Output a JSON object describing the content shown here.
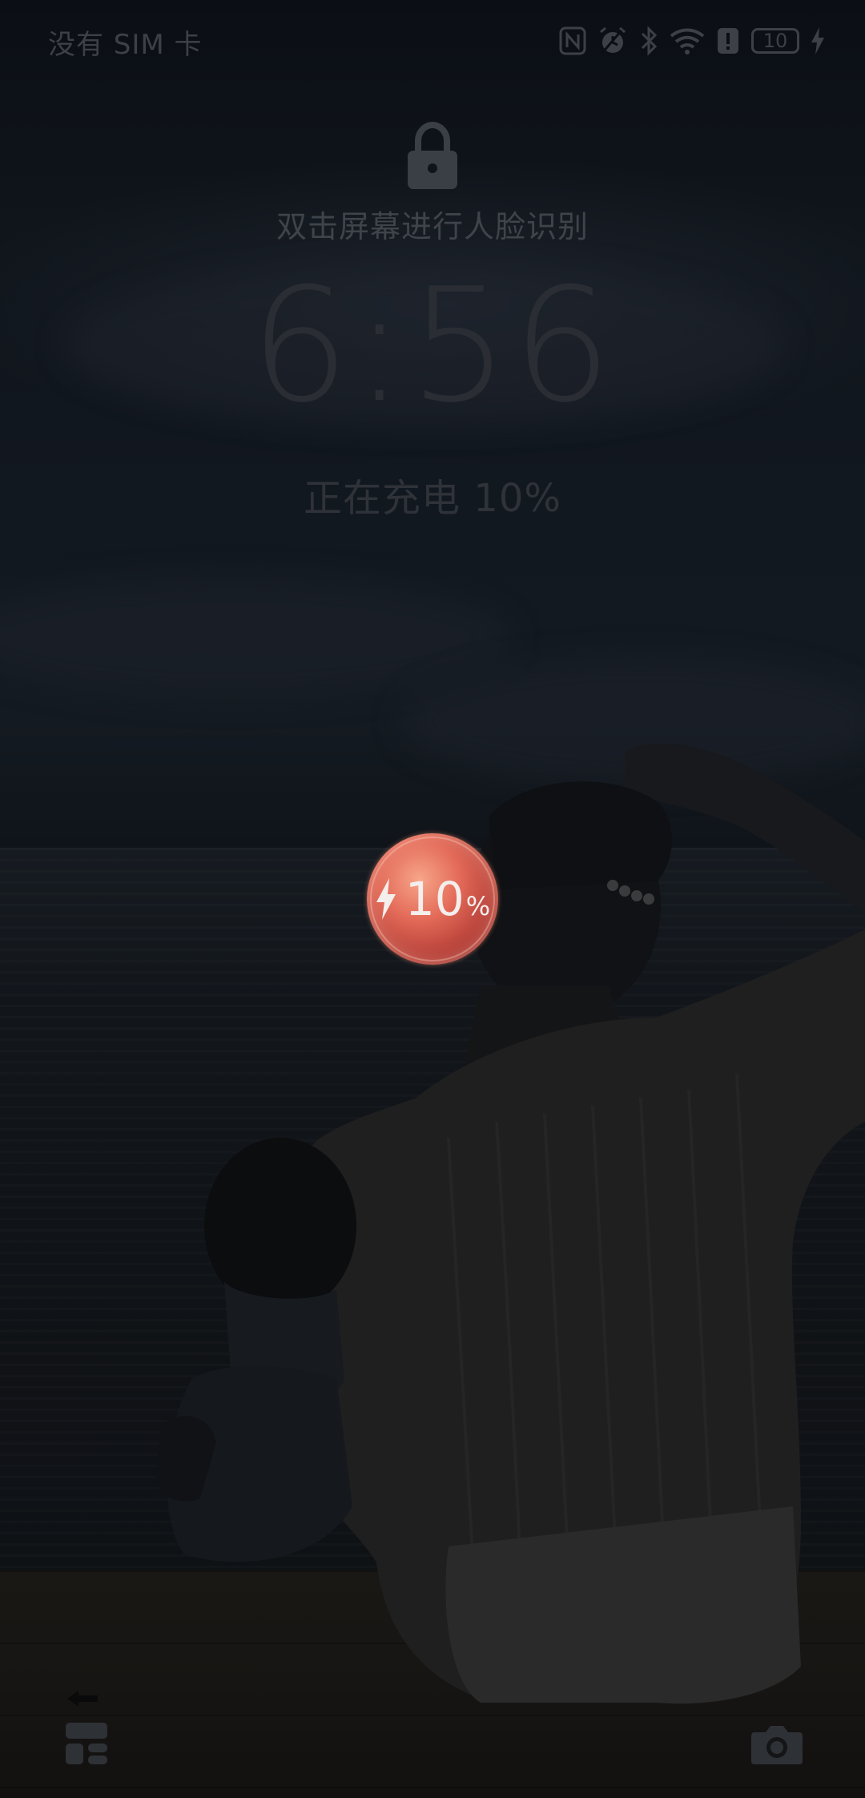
{
  "status_bar": {
    "carrier": "没有 SIM 卡",
    "battery_level": "10",
    "icons": [
      "nfc-icon",
      "alarm-icon",
      "bluetooth-icon",
      "wifi-icon",
      "notification-alert-icon",
      "battery-icon",
      "charging-bolt-icon"
    ]
  },
  "lock_screen": {
    "lock_icon": "lock-icon",
    "face_unlock_hint": "双击屏幕进行人脸识别",
    "time": "6:56",
    "charging_status": "正在充电 10%"
  },
  "charge_indicator": {
    "value": "10",
    "unit": "%",
    "icon": "charging-bolt-icon",
    "color": "#e36a58"
  },
  "shortcuts": {
    "left_icon": "widgets-icon",
    "right_icon": "camera-icon"
  },
  "colors": {
    "background": "#0a0d12",
    "dim_text": "#3f434a",
    "orb_accent": "#e36a58"
  }
}
